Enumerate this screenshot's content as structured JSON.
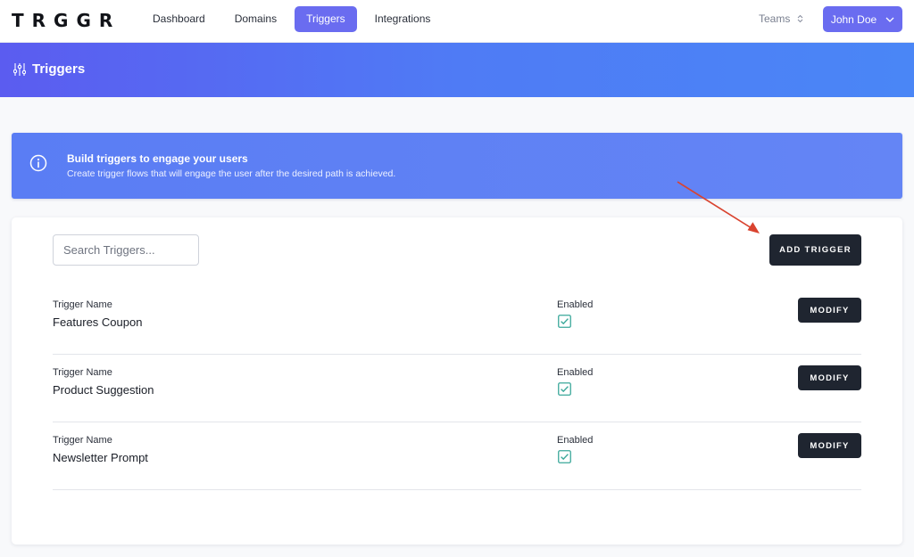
{
  "nav": {
    "logo": "TRGGR",
    "links": [
      {
        "label": "Dashboard",
        "active": false
      },
      {
        "label": "Domains",
        "active": false
      },
      {
        "label": "Triggers",
        "active": true
      },
      {
        "label": "Integrations",
        "active": false
      }
    ],
    "teams_label": "Teams",
    "user_label": "John Doe"
  },
  "header": {
    "title": "Triggers",
    "icon": "sliders-icon"
  },
  "banner": {
    "icon": "info-icon",
    "title": "Build triggers to engage your users",
    "subtitle": "Create trigger flows that will engage the user after the desired path is achieved."
  },
  "toolbar": {
    "search_placeholder": "Search Triggers...",
    "add_label": "ADD TRIGGER"
  },
  "triggers": [
    {
      "name_label": "Trigger Name",
      "name": "Features Coupon",
      "enabled_label": "Enabled",
      "enabled": true,
      "modify_label": "MODIFY"
    },
    {
      "name_label": "Trigger Name",
      "name": "Product Suggestion",
      "enabled_label": "Enabled",
      "enabled": true,
      "modify_label": "MODIFY"
    },
    {
      "name_label": "Trigger Name",
      "name": "Newsletter Prompt",
      "enabled_label": "Enabled",
      "enabled": true,
      "modify_label": "MODIFY"
    }
  ],
  "colors": {
    "accent": "#6a6cf0",
    "dark_button": "#1f2530",
    "check": "#3aa89a",
    "annotation_arrow": "#d9432f"
  }
}
